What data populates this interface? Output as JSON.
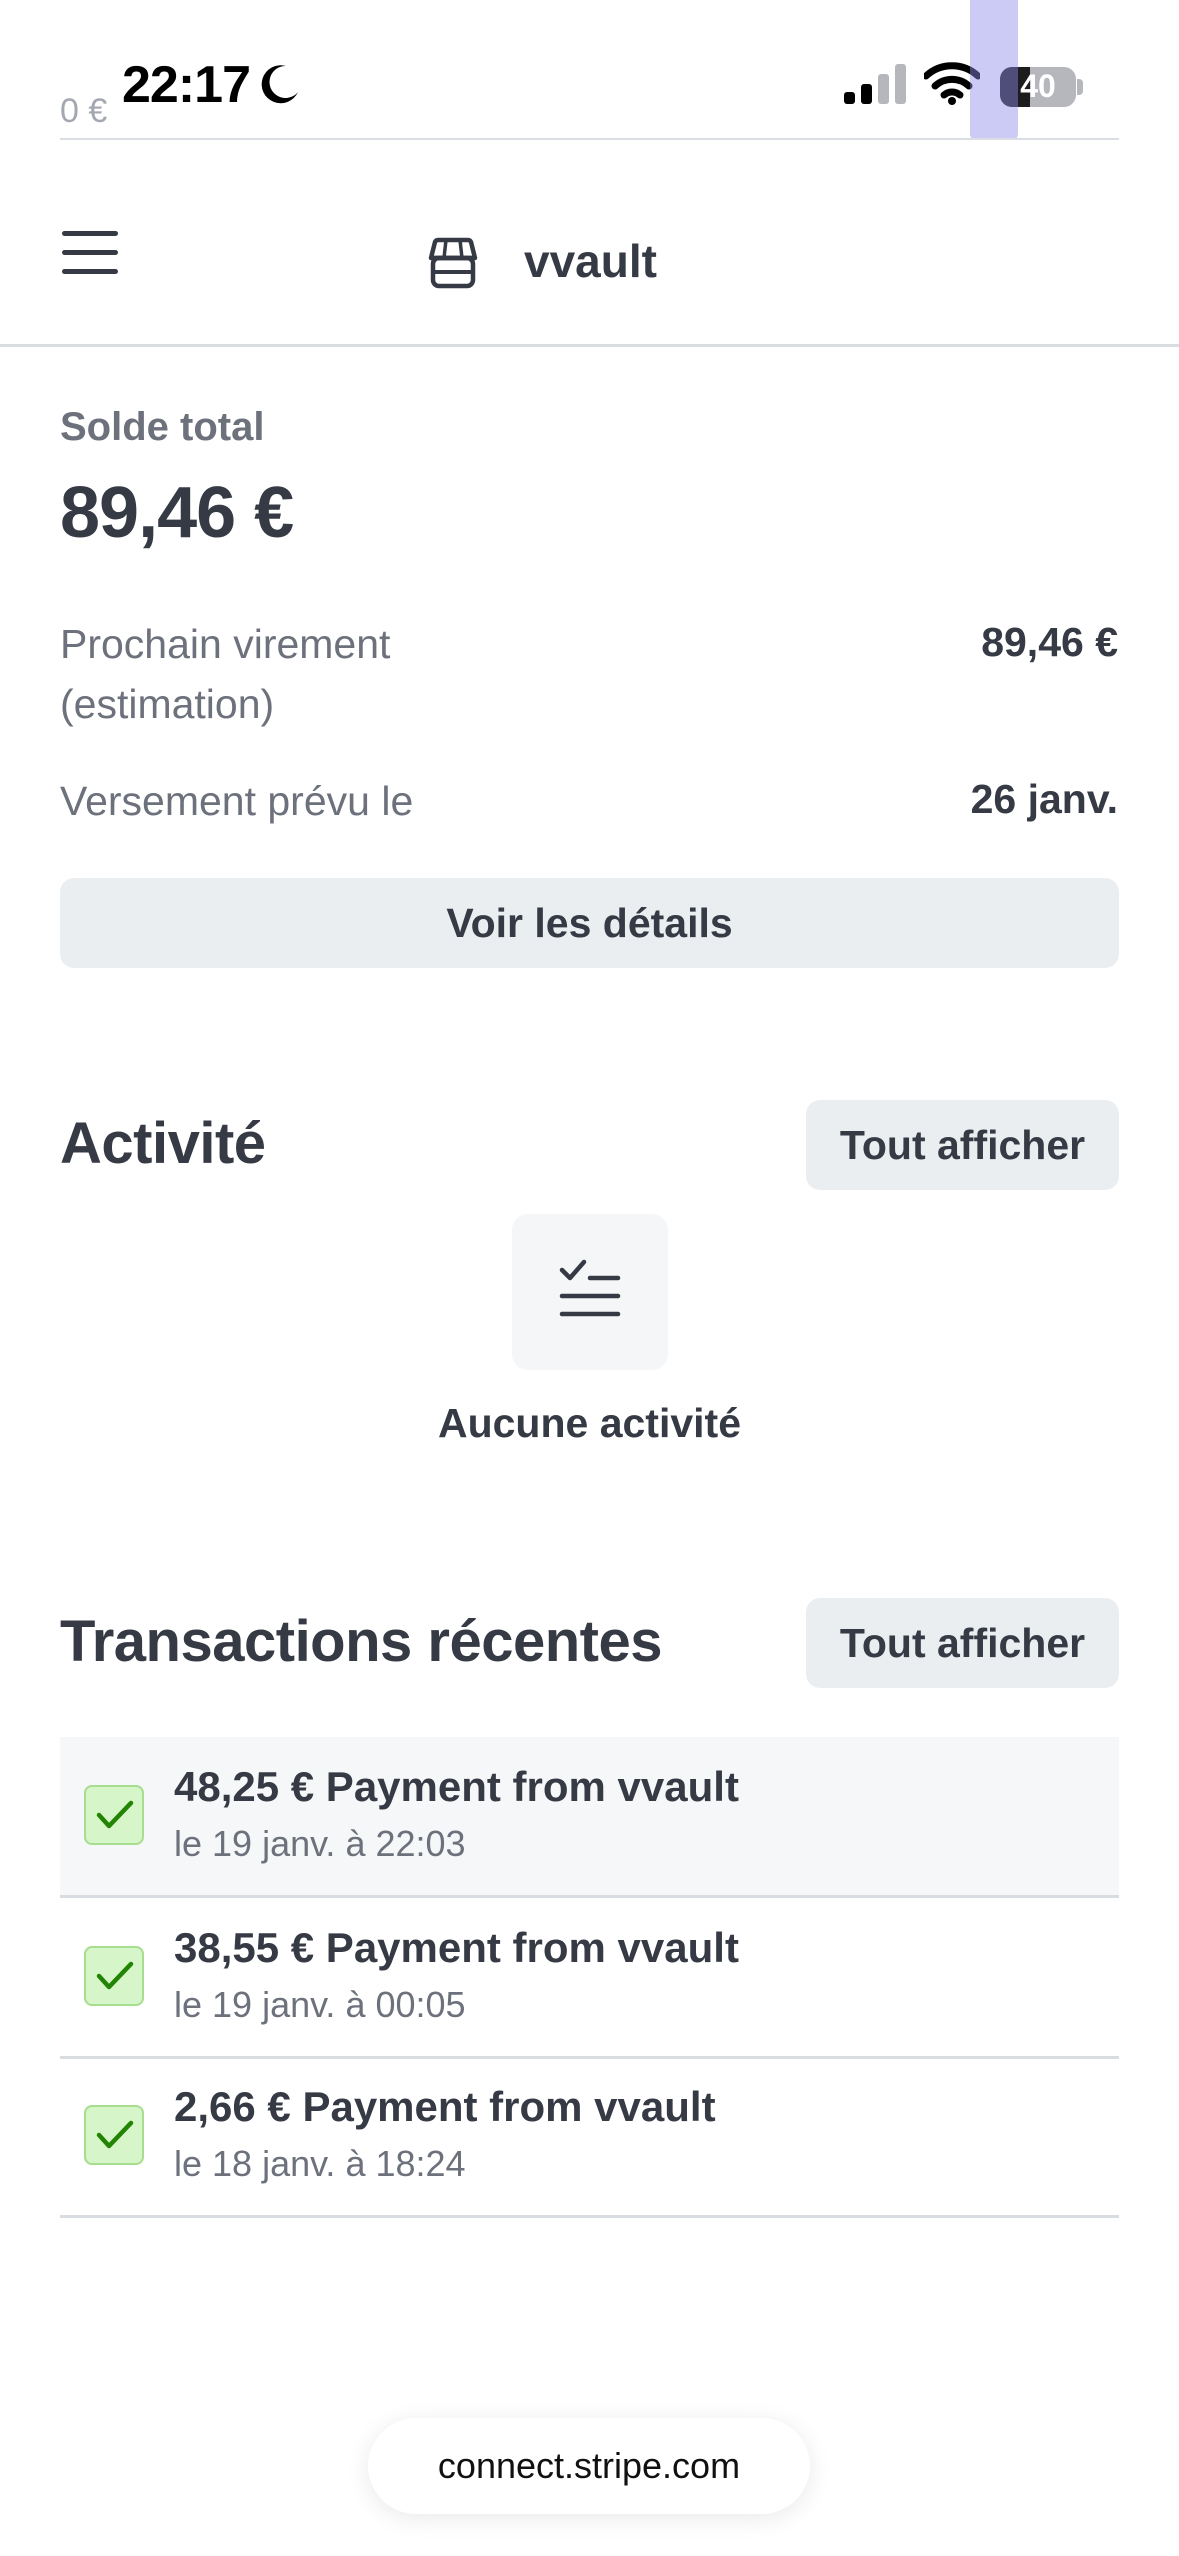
{
  "status_bar": {
    "time": "22:17",
    "battery": "40",
    "ghost_amount": "0 €",
    "icons": [
      "moon-icon",
      "signal-icon",
      "wifi-icon",
      "battery-icon"
    ]
  },
  "header": {
    "brand": "vvault",
    "icons": [
      "menu-icon",
      "store-icon"
    ]
  },
  "balance": {
    "label": "Solde total",
    "value": "89,46 €",
    "next_transfer_label": "Prochain virement (estimation)",
    "next_transfer_value": "89,46 €",
    "payout_label": "Versement prévu le",
    "payout_value": "26 janv.",
    "details_button": "Voir les détails"
  },
  "activity": {
    "title": "Activité",
    "show_all": "Tout afficher",
    "empty_text": "Aucune activité",
    "empty_icon": "checklist-icon"
  },
  "transactions": {
    "title": "Transactions récentes",
    "show_all": "Tout afficher",
    "items": [
      {
        "title": "48,25 € Payment from vvault",
        "date": "le 19 janv. à 22:03",
        "status_icon": "check-icon"
      },
      {
        "title": "38,55 € Payment from vvault",
        "date": "le 19 janv. à 00:05",
        "status_icon": "check-icon"
      },
      {
        "title": "2,66 € Payment from vvault",
        "date": "le 18 janv. à 18:24",
        "status_icon": "check-icon"
      }
    ]
  },
  "browser": {
    "url": "connect.stripe.com"
  },
  "colors": {
    "text_primary": "#353a44",
    "text_secondary": "#6c717c",
    "button_bg": "#ebeef1",
    "success_bg": "#d6f5c8",
    "success_check": "#228403"
  }
}
